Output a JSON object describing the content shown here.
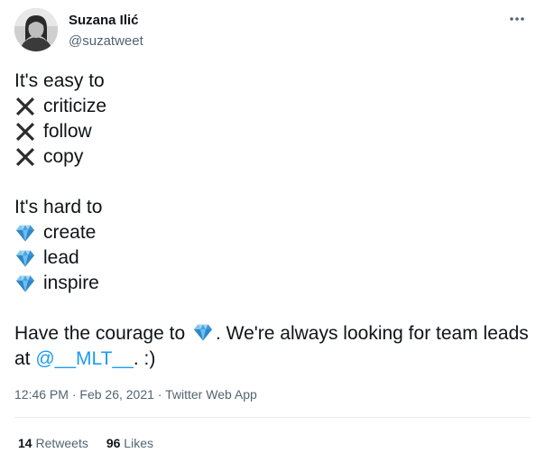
{
  "author": {
    "name": "Suzana Ilić",
    "handle": "@suzatweet"
  },
  "tweet": {
    "para1_intro": "It's easy to",
    "easy_items": [
      "criticize",
      "follow",
      "copy"
    ],
    "para2_intro": "It's hard to",
    "hard_items": [
      "create",
      "lead",
      "inspire"
    ],
    "para3_start": "Have the courage to",
    "para3_mid": ". We're always looking for team leads at",
    "mention": "@__MLT__",
    "para3_end": ". :)"
  },
  "meta": {
    "time": "12:46 PM",
    "sep1": " · ",
    "date": "Feb 26, 2021",
    "sep2": " · ",
    "source": "Twitter Web App"
  },
  "stats": {
    "retweets_count": "14",
    "retweets_label": "Retweets",
    "likes_count": "96",
    "likes_label": "Likes"
  },
  "icons": {
    "cross": "cross-mark-icon",
    "gem": "gem-icon",
    "more": "more-options-icon"
  },
  "colors": {
    "text": "#0f1419",
    "secondary": "#536471",
    "link": "#1d9bf0"
  }
}
